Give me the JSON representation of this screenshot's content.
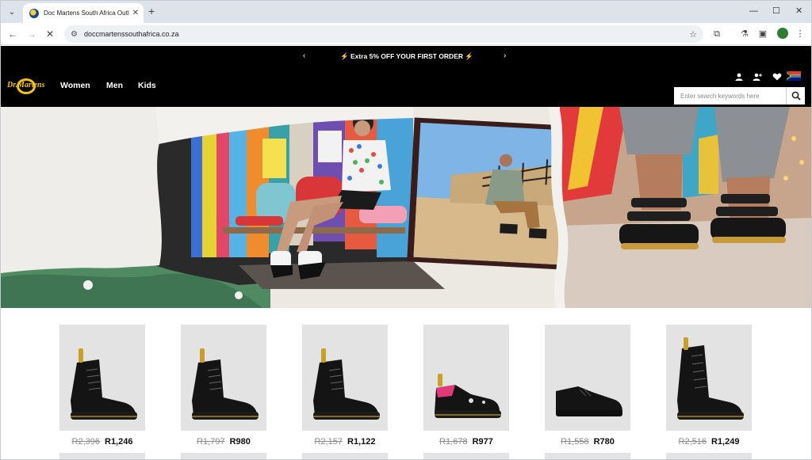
{
  "browser": {
    "tab_title": "Doc Martens South Africa Outl",
    "url": "doccmartenssouthafrica.co.za"
  },
  "site": {
    "promo_text": "⚡ Extra 5% OFF YOUR FIRST ORDER ⚡",
    "logo_text": "Dr. Martens",
    "nav": [
      "Women",
      "Men",
      "Kids"
    ],
    "search_placeholder": "Enter search keywords here"
  },
  "products": [
    {
      "old_price": "R2,396",
      "price": "R1,246",
      "style": "boot-8"
    },
    {
      "old_price": "R1,797",
      "price": "R980",
      "style": "boot-8"
    },
    {
      "old_price": "R2,157",
      "price": "R1,122",
      "style": "boot-8"
    },
    {
      "old_price": "R1,678",
      "price": "R977",
      "style": "shoe-pink"
    },
    {
      "old_price": "R1,558",
      "price": "R780",
      "style": "shoe"
    },
    {
      "old_price": "R2,516",
      "price": "R1,249",
      "style": "boot-tall"
    }
  ]
}
